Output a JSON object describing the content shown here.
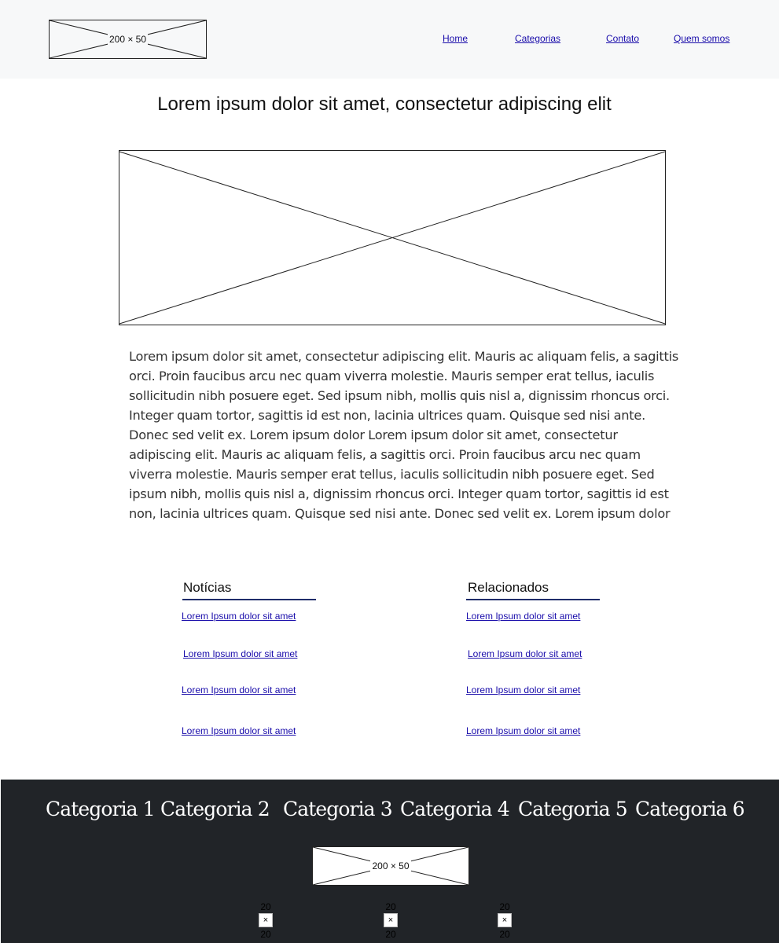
{
  "header": {
    "logo_label": "200 × 50",
    "nav": [
      "Home",
      "Categorias",
      "Contato",
      "Quem somos"
    ]
  },
  "main": {
    "title": "Lorem ipsum dolor sit amet, consectetur adipiscing elit",
    "body": "Lorem ipsum dolor sit amet, consectetur adipiscing elit. Mauris ac aliquam felis, a sagittis orci. Proin faucibus arcu nec quam viverra molestie. Mauris semper erat tellus, iaculis sollicitudin nibh posuere eget. Sed ipsum nibh, mollis quis nisl a, dignissim rhoncus orci. Integer quam tortor, sagittis id est non, lacinia ultrices quam. Quisque sed nisi ante. Donec sed velit ex. Lorem ipsum dolor  Lorem ipsum dolor sit amet, consectetur adipiscing elit. Mauris ac aliquam felis, a sagittis orci. Proin faucibus arcu nec quam viverra molestie. Mauris semper erat tellus, iaculis sollicitudin nibh posuere eget. Sed ipsum nibh, mollis quis nisl a, dignissim rhoncus orci. Integer quam tortor, sagittis id est non, lacinia ultrices quam. Quisque sed nisi ante. Donec sed velit ex. Lorem ipsum dolor"
  },
  "noticias": {
    "heading": "Notícias",
    "links": [
      "Lorem Ipsum dolor sit amet",
      "Lorem Ipsum dolor sit amet",
      "Lorem Ipsum dolor sit amet",
      "Lorem Ipsum dolor sit amet"
    ]
  },
  "relacionados": {
    "heading": "Relacionados",
    "links": [
      "Lorem Ipsum dolor sit amet",
      "Lorem Ipsum dolor sit amet",
      "Lorem Ipsum dolor sit amet",
      "Lorem Ipsum dolor sit amet"
    ]
  },
  "footer": {
    "categories": [
      "Categoria 1",
      "Categoria 2",
      "Categoria 3",
      "Categoria 4",
      "Categoria 5",
      "Categoria 6"
    ],
    "logo_label": "200 × 50",
    "icons": [
      {
        "top": "20",
        "glyph": "×",
        "bottom": "20"
      },
      {
        "top": "20",
        "glyph": "×",
        "bottom": "20"
      },
      {
        "top": "20",
        "glyph": "×",
        "bottom": "20"
      }
    ]
  },
  "colors": {
    "header_bg": "#f7f8f9",
    "footer_bg": "#212428",
    "link": "#1a0dab",
    "heading_rule": "#1f2d6b"
  }
}
